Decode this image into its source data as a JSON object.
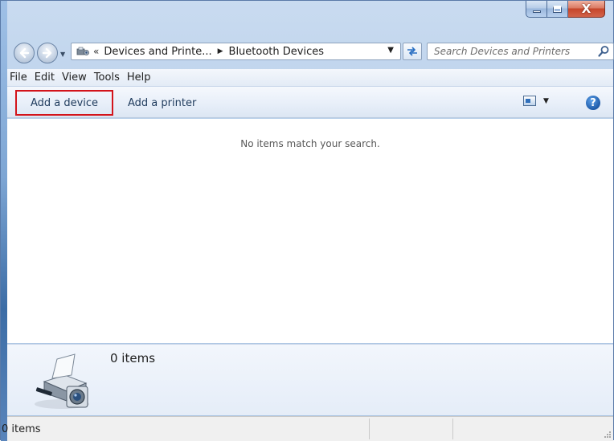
{
  "window": {
    "caption": {
      "close_glyph": "X"
    }
  },
  "nav": {
    "address": {
      "chevron": "«",
      "crumbs": [
        "Devices and Printe...",
        "Bluetooth Devices"
      ],
      "separator": "▶"
    },
    "search": {
      "placeholder": "Search Devices and Printers"
    }
  },
  "menu": {
    "items": [
      "File",
      "Edit",
      "View",
      "Tools",
      "Help"
    ]
  },
  "commandbar": {
    "add_device": "Add a device",
    "add_printer": "Add a printer",
    "help_glyph": "?"
  },
  "content": {
    "empty_message": "No items match your search."
  },
  "details": {
    "count": "0 items"
  },
  "status": {
    "text": "0 items"
  },
  "colors": {
    "highlight_border": "#d3141b",
    "title_glass": "#b6cde9",
    "close_button": "#c6462a"
  }
}
